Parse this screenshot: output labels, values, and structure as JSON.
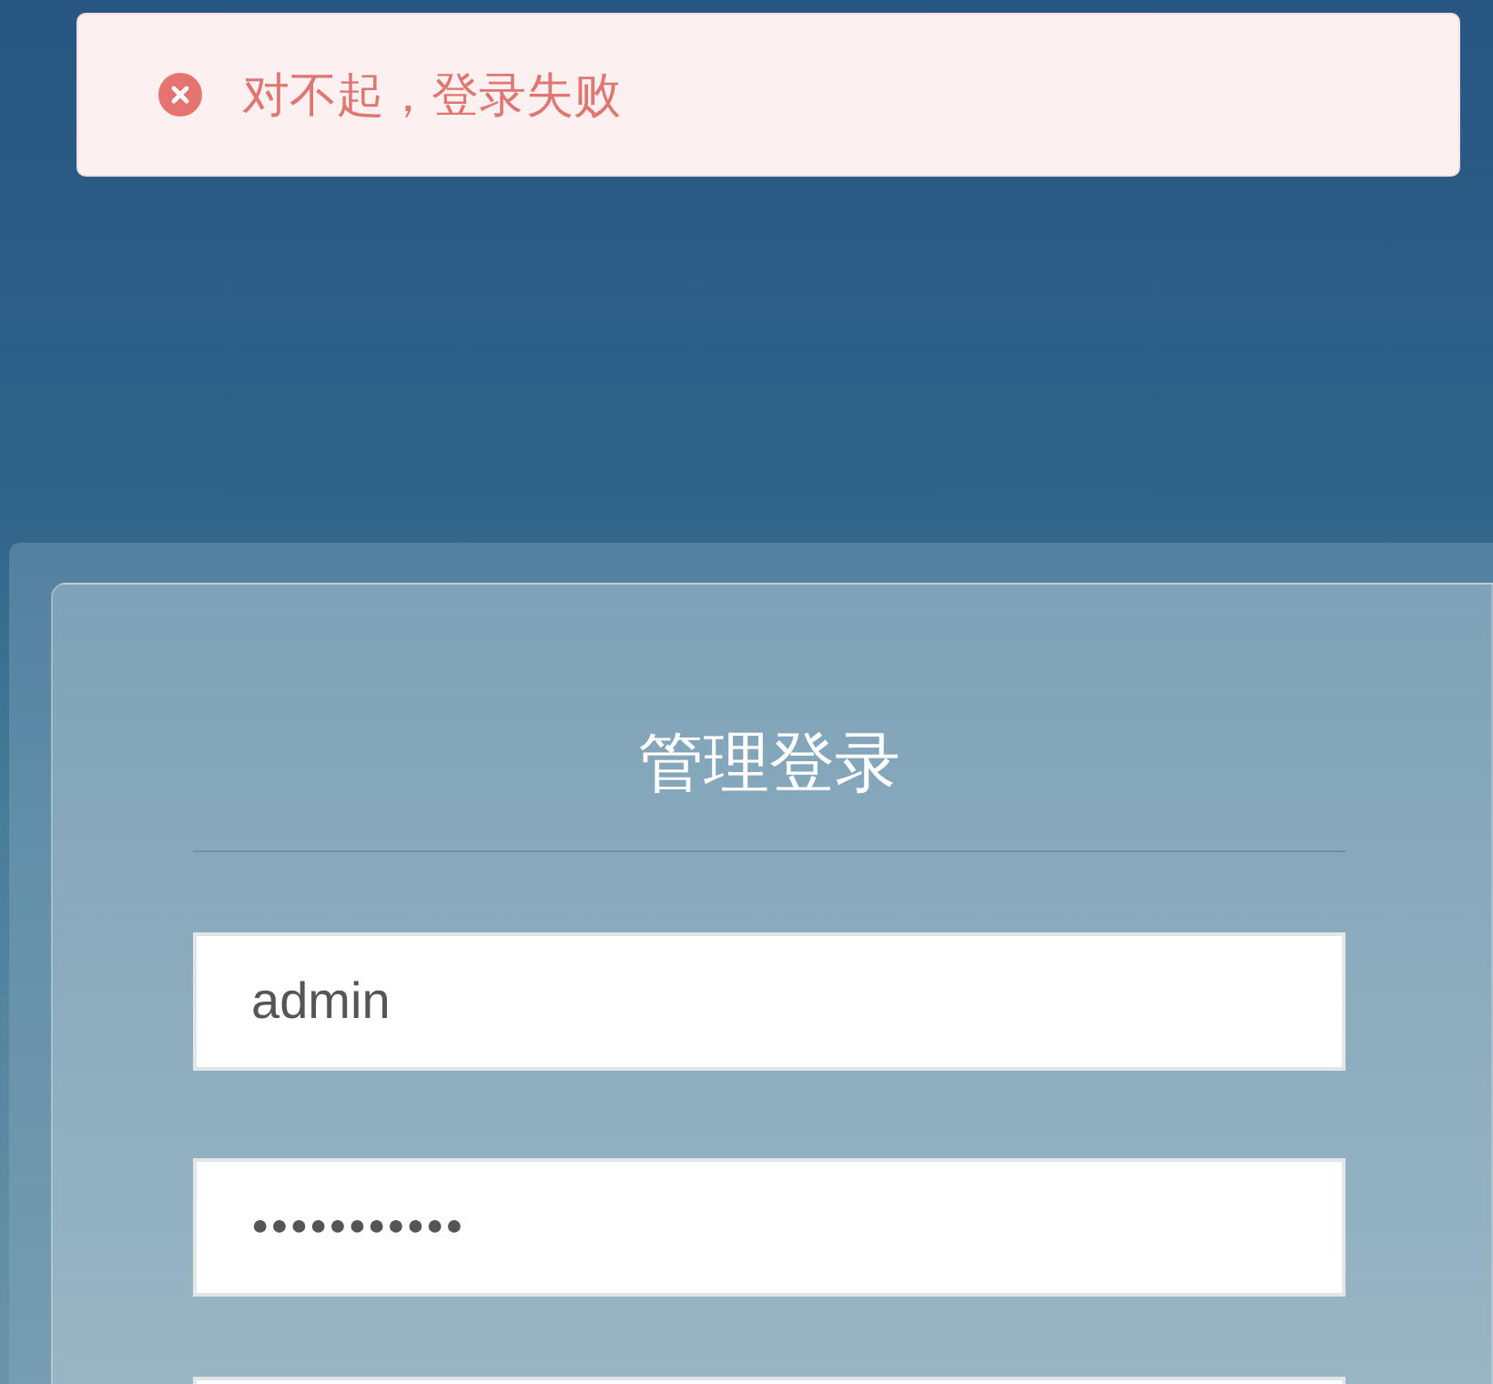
{
  "alert": {
    "kind": "error",
    "message": "对不起，登录失败"
  },
  "login": {
    "title": "管理登录",
    "fields": [
      {
        "kind": "text",
        "value": "admin"
      },
      {
        "kind": "password",
        "value": "●●●●●●●●●●●"
      }
    ]
  }
}
